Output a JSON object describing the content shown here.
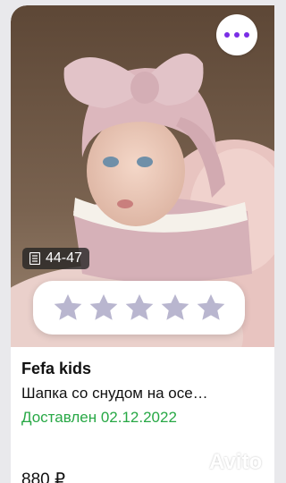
{
  "listing": {
    "seller": "Fefa kids",
    "title": "Шапка со снудом на осе…",
    "status": "Доставлен 02.12.2022",
    "price": "880 ₽",
    "size_badge": "44-47",
    "rating_stars": 0,
    "rating_max": 5
  },
  "watermark": {
    "text": "Avito"
  },
  "icons": {
    "menu": "more-dots-icon",
    "size": "document-icon",
    "star": "star-icon"
  },
  "colors": {
    "accent": "#7a2ee6",
    "status_green": "#27a845",
    "star_empty": "#b9b6cf"
  }
}
